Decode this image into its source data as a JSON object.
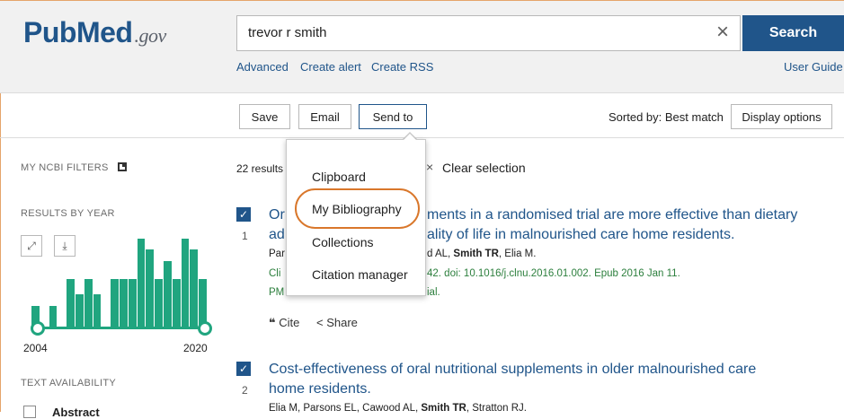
{
  "header": {
    "logo_pub": "Pub",
    "logo_med": "Med",
    "logo_gov": ".gov",
    "search_value": "trevor r smith",
    "clear_icon": "×",
    "search_label": "Search",
    "advanced": "Advanced",
    "create_alert": "Create alert",
    "create_rss": "Create RSS",
    "user_guide": "User Guide"
  },
  "toolbar": {
    "save": "Save",
    "email": "Email",
    "send_to": "Send to",
    "sorted_by": "Sorted by: Best match",
    "display_options": "Display options"
  },
  "sidebar": {
    "my_ncbi_filters": "MY NCBI FILTERS",
    "results_by_year": "RESULTS BY YEAR",
    "expand_icon": "⤢",
    "download_icon": "⤓",
    "year_start": "2004",
    "year_end": "2020",
    "text_availability": "TEXT AVAILABILITY",
    "abstract": "Abstract",
    "histogram": [
      0.25,
      0.0,
      0.25,
      0.0,
      0.55,
      0.38,
      0.55,
      0.38,
      0.0,
      0.55,
      0.55,
      0.55,
      1.0,
      0.88,
      0.55,
      0.75,
      0.55,
      1.0,
      0.88,
      0.55
    ],
    "accent_color": "#20a57f"
  },
  "results": {
    "count_text": "22 results",
    "clear_selection": "Clear selection",
    "clear_icon": "×",
    "items": [
      {
        "index": "1",
        "check": "✓",
        "title_a": "Or",
        "title_b": "ments in a randomised trial are more effective than dietary",
        "title_c": "ad",
        "title_d": "ality of life in malnourished care home residents.",
        "authors_a": "Par",
        "authors_b": "d AL, ",
        "authors_bold": "Smith TR",
        "authors_c": ", Elia M.",
        "journal_a": "Cli",
        "journal_b": "42. doi: 10.1016/j.clnu.2016.01.002. Epub 2016 Jan 11.",
        "pmid_a": "PM",
        "pmid_b": "ial.",
        "cite": "Cite",
        "share": "Share"
      },
      {
        "index": "2",
        "check": "✓",
        "title_a": "Cost-effectiveness of oral nutritional supplements in older malnourished care",
        "title_b": "home residents.",
        "authors_a": "Elia M, Parsons EL, Cawood AL, ",
        "authors_bold": "Smith TR",
        "authors_c": ", Stratton RJ."
      }
    ]
  },
  "send_to_menu": {
    "items": [
      "Clipboard",
      "My Bibliography",
      "Collections",
      "Citation manager"
    ]
  }
}
